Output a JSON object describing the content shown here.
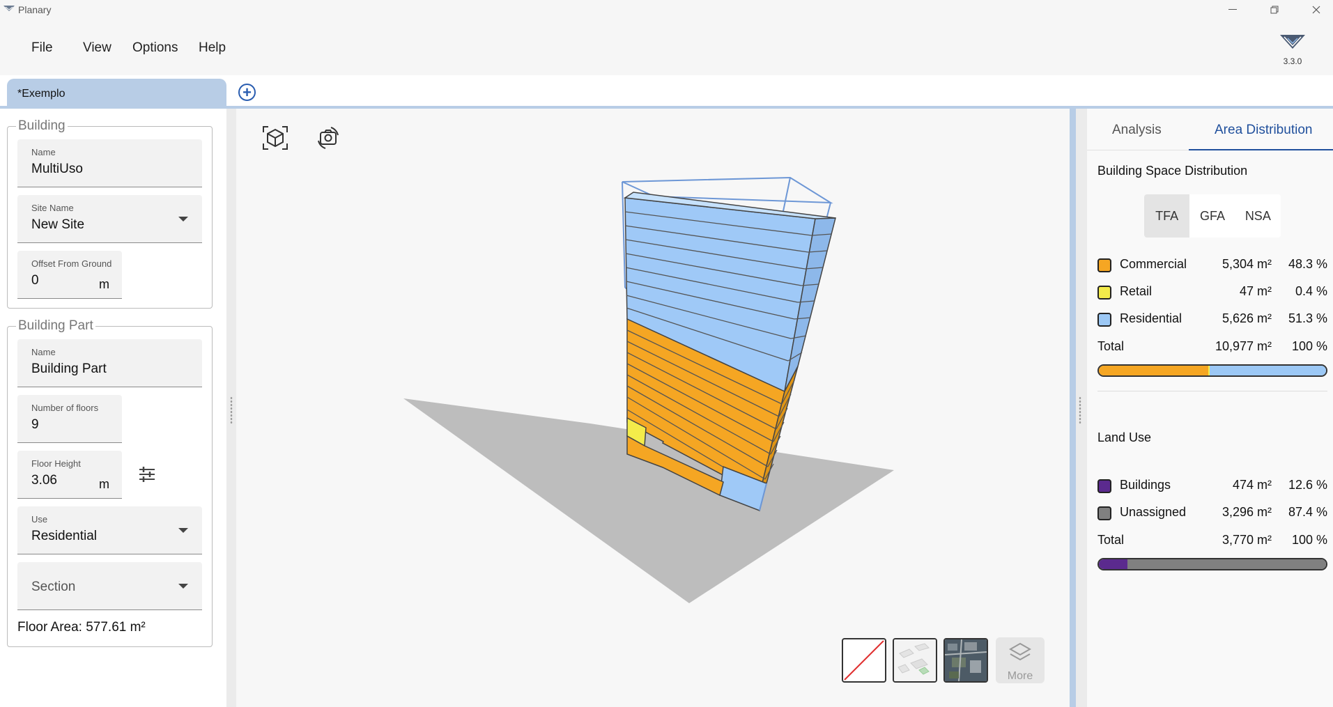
{
  "window": {
    "app_title": "Planary"
  },
  "menu": {
    "file": "File",
    "view": "View",
    "options": "Options",
    "help": "Help",
    "version": "3.3.0"
  },
  "tabs": {
    "active_doc": "*Exemplo"
  },
  "building": {
    "group_title": "Building",
    "name_label": "Name",
    "name_value": "MultiUso",
    "site_label": "Site Name",
    "site_value": "New Site",
    "offset_label": "Offset From Ground",
    "offset_value": "0",
    "offset_unit": "m"
  },
  "building_part": {
    "group_title": "Building Part",
    "name_label": "Name",
    "name_value": "Building Part",
    "floors_label": "Number of floors",
    "floors_value": "9",
    "height_label": "Floor Height",
    "height_value": "3.06",
    "height_unit": "m",
    "use_label": "Use",
    "use_value": "Residential",
    "section_placeholder": "Section",
    "floor_area": "Floor Area: 577.61 m²"
  },
  "viewport": {
    "icons": [
      "cube-view-icon",
      "screenshot-camera-icon"
    ],
    "basemaps": [
      "none-basemap",
      "buildings-basemap",
      "satellite-basemap"
    ],
    "more_label": "More"
  },
  "right_panel": {
    "tab_analysis": "Analysis",
    "tab_area": "Area Distribution",
    "space_title": "Building Space Distribution",
    "modes": [
      "TFA",
      "GFA",
      "NSA"
    ],
    "active_mode": "TFA",
    "space_rows": [
      {
        "name": "Commercial",
        "area": "5,304 m²",
        "pct": "48.3 %",
        "color": "#f5a623",
        "share": 0.483
      },
      {
        "name": "Retail",
        "area": "47 m²",
        "pct": "0.4 %",
        "color": "#f4ec4a",
        "share": 0.004
      },
      {
        "name": "Residential",
        "area": "5,626 m²",
        "pct": "51.3 %",
        "color": "#9cc8f5",
        "share": 0.513
      }
    ],
    "space_total": {
      "label": "Total",
      "area": "10,977 m²",
      "pct": "100 %"
    },
    "land_title": "Land Use",
    "land_rows": [
      {
        "name": "Buildings",
        "area": "474 m²",
        "pct": "12.6 %",
        "color": "#5b2a8e",
        "share": 0.126
      },
      {
        "name": "Unassigned",
        "area": "3,296 m²",
        "pct": "87.4 %",
        "color": "#808080",
        "share": 0.874
      }
    ],
    "land_total": {
      "label": "Total",
      "area": "3,770 m²",
      "pct": "100 %"
    }
  }
}
